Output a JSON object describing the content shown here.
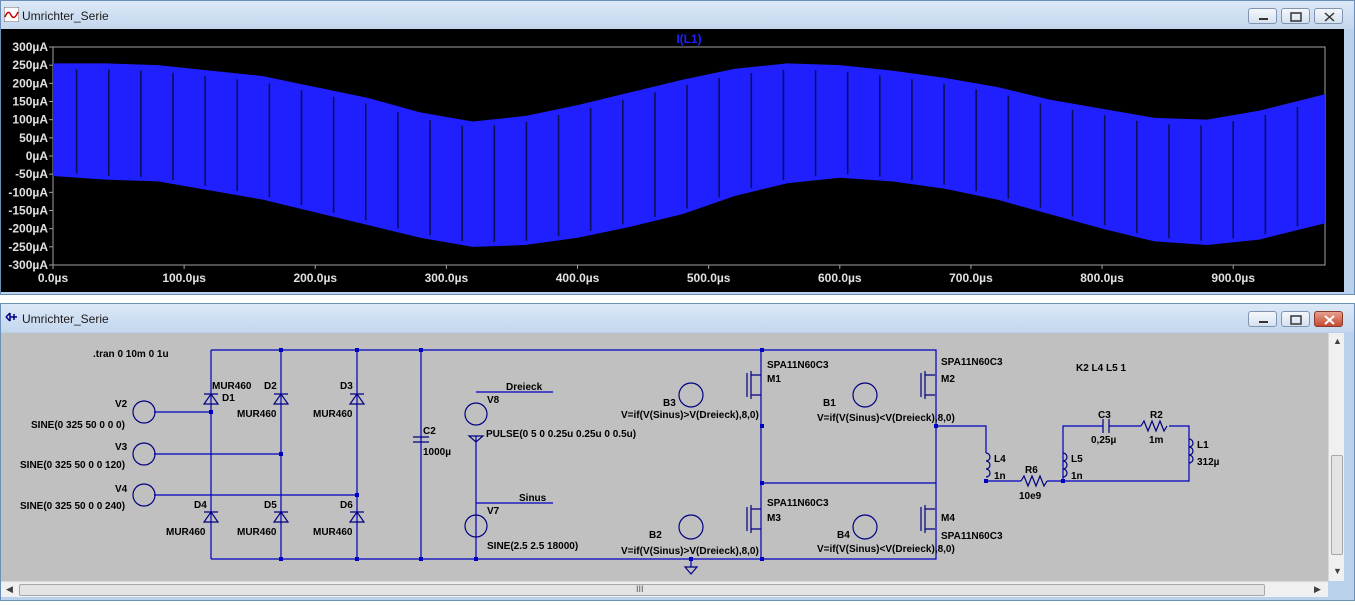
{
  "waveform_window": {
    "title": "Umrichter_Serie",
    "trace_label": "I(L1)",
    "buttons": {
      "minimize": "minimize",
      "maximize": "maximize",
      "close": "close"
    }
  },
  "chart_data": {
    "type": "line",
    "title": "I(L1)",
    "xlabel": "",
    "ylabel": "",
    "x_ticks": [
      "0.0µs",
      "100.0µs",
      "200.0µs",
      "300.0µs",
      "400.0µs",
      "500.0µs",
      "600.0µs",
      "700.0µs",
      "800.0µs",
      "900.0µs"
    ],
    "y_ticks": [
      "300µA",
      "250µA",
      "200µA",
      "150µA",
      "100µA",
      "50µA",
      "0µA",
      "-50µA",
      "-100µA",
      "-150µA",
      "-200µA",
      "-250µA",
      "-300µA"
    ],
    "xlim": [
      0,
      970
    ],
    "ylim": [
      -300,
      300
    ],
    "x_units": "µs",
    "y_units": "µA",
    "series": [
      {
        "name": "I(L1)",
        "color": "#2020ff",
        "description_type": "band",
        "x": [
          0,
          40,
          80,
          120,
          160,
          200,
          240,
          280,
          320,
          360,
          400,
          440,
          480,
          520,
          560,
          600,
          640,
          680,
          720,
          760,
          800,
          840,
          880,
          920,
          970
        ],
        "upper": [
          255,
          255,
          250,
          235,
          220,
          190,
          160,
          120,
          95,
          110,
          140,
          175,
          210,
          240,
          255,
          250,
          235,
          215,
          190,
          155,
          130,
          105,
          100,
          125,
          170
        ],
        "lower": [
          -55,
          -65,
          -70,
          -95,
          -120,
          -155,
          -190,
          -225,
          -250,
          -245,
          -225,
          -195,
          -160,
          -110,
          -75,
          -60,
          -70,
          -90,
          -120,
          -160,
          -200,
          -235,
          -245,
          -230,
          -185
        ]
      }
    ],
    "grid": false,
    "background": "#000000"
  },
  "schematic_window": {
    "title": "Umrichter_Serie",
    "directive_tran": ".tran 0 10m 0 1u",
    "directive_k": "K2 L4 L5 1",
    "sources": {
      "v2": {
        "name": "V2",
        "value": "SINE(0 325 50 0 0 0)"
      },
      "v3": {
        "name": "V3",
        "value": "SINE(0 325 50 0 0 120)"
      },
      "v4": {
        "name": "V4",
        "value": "SINE(0 325 50 0 0 240)"
      },
      "v8": {
        "name": "V8",
        "value": "PULSE(0 5 0 0.25u 0.25u 0 0.5u)",
        "net": "Dreieck"
      },
      "v7": {
        "name": "V7",
        "value": "SINE(2.5 2.5 18000)",
        "net": "Sinus"
      }
    },
    "diodes": {
      "d1": {
        "name": "D1",
        "model": "MUR460"
      },
      "d2": {
        "name": "D2",
        "model": "MUR460"
      },
      "d3": {
        "name": "D3",
        "model": "MUR460"
      },
      "d4": {
        "name": "D4",
        "model": "MUR460"
      },
      "d5": {
        "name": "D5",
        "model": "MUR460"
      },
      "d6": {
        "name": "D6",
        "model": "MUR460"
      }
    },
    "c2": {
      "name": "C2",
      "value": "1000µ"
    },
    "c3": {
      "name": "C3",
      "value": "0,25µ"
    },
    "r2": {
      "name": "R2",
      "value": "1m"
    },
    "r6": {
      "name": "R6",
      "value": "10e9"
    },
    "l1": {
      "name": "L1",
      "value": "312µ"
    },
    "l4": {
      "name": "L4",
      "value": "1n"
    },
    "l5": {
      "name": "L5",
      "value": "1n"
    },
    "mosfets": {
      "m1": {
        "name": "M1",
        "model": "SPA11N60C3"
      },
      "m2": {
        "name": "M2",
        "model": "SPA11N60C3"
      },
      "m3": {
        "name": "M3",
        "model": "SPA11N60C3"
      },
      "m4": {
        "name": "M4",
        "model": "SPA11N60C3"
      }
    },
    "behavioral": {
      "b1": {
        "name": "B1",
        "expr": "V=if(V(Sinus)<V(Dreieck),8,0)"
      },
      "b2": {
        "name": "B2",
        "expr": "V=if(V(Sinus)>V(Dreieck),8,0)"
      },
      "b3": {
        "name": "B3",
        "expr": "V=if(V(Sinus)>V(Dreieck),8,0)"
      },
      "b4": {
        "name": "B4",
        "expr": "V=if(V(Sinus)<V(Dreieck),8,0)"
      }
    },
    "scroll_grip": "III"
  }
}
